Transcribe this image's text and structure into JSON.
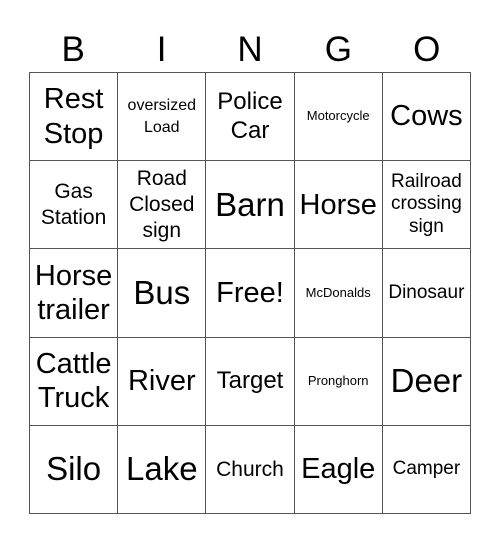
{
  "header": [
    "B",
    "I",
    "N",
    "G",
    "O"
  ],
  "cells": [
    {
      "text": "Rest Stop",
      "size": "l"
    },
    {
      "text": "oversized Load",
      "size": "xs"
    },
    {
      "text": "Police Car",
      "size": "m"
    },
    {
      "text": "Motorcycle",
      "size": "xxs"
    },
    {
      "text": "Cows",
      "size": "l"
    },
    {
      "text": "Gas Station",
      "size": "ms"
    },
    {
      "text": "Road Closed sign",
      "size": "ms"
    },
    {
      "text": "Barn",
      "size": "xl"
    },
    {
      "text": "Horse",
      "size": "l"
    },
    {
      "text": "Railroad crossing sign",
      "size": "s"
    },
    {
      "text": "Horse trailer",
      "size": "l"
    },
    {
      "text": "Bus",
      "size": "xl"
    },
    {
      "text": "Free!",
      "size": "l"
    },
    {
      "text": "McDonalds",
      "size": "xxs"
    },
    {
      "text": "Dinosaur",
      "size": "s"
    },
    {
      "text": "Cattle Truck",
      "size": "l"
    },
    {
      "text": "River",
      "size": "l"
    },
    {
      "text": "Target",
      "size": "m"
    },
    {
      "text": "Pronghorn",
      "size": "xxs"
    },
    {
      "text": "Deer",
      "size": "xl"
    },
    {
      "text": "Silo",
      "size": "xl"
    },
    {
      "text": "Lake",
      "size": "xl"
    },
    {
      "text": "Church",
      "size": "ms"
    },
    {
      "text": "Eagle",
      "size": "l"
    },
    {
      "text": "Camper",
      "size": "s"
    }
  ]
}
